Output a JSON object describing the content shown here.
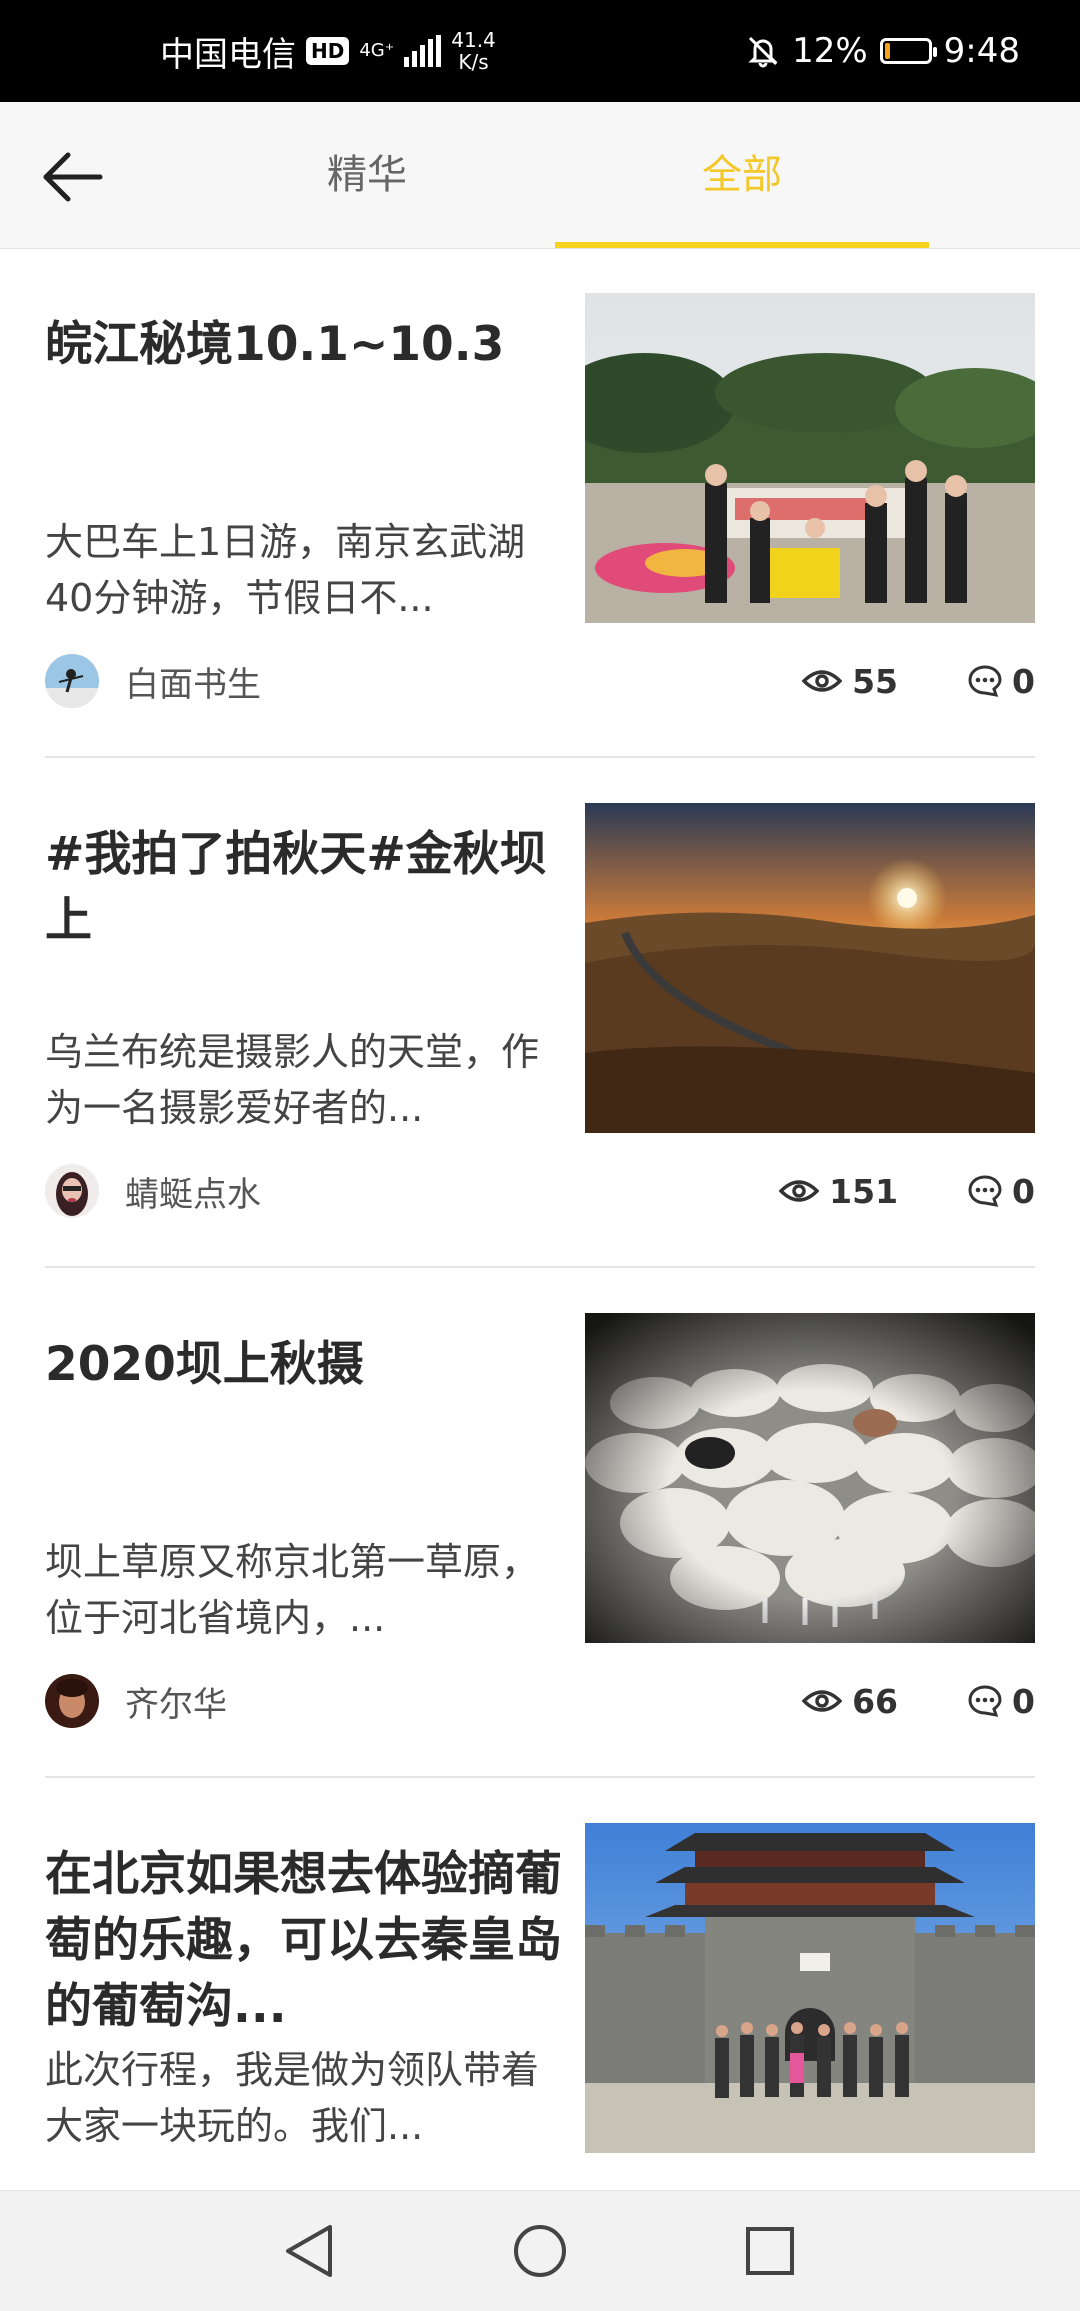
{
  "status_bar": {
    "carrier": "中国电信",
    "hd": "HD",
    "network": "4G⁺",
    "speed_value": "41.4",
    "speed_unit": "K/s",
    "battery": "12%",
    "battery_level": 0.12,
    "time": "9:48"
  },
  "header": {
    "tabs": [
      {
        "label": "精华",
        "active": false
      },
      {
        "label": "全部",
        "active": true
      }
    ],
    "accent_color": "#f5c829"
  },
  "posts": [
    {
      "title": "皖江秘境10.1~10.3",
      "summary": "大巴车上1日游，南京玄武湖40分钟游，节假日不...",
      "author": "白面书生",
      "views": "55",
      "comments": "0"
    },
    {
      "title": "#我拍了拍秋天#金秋坝上",
      "summary": "乌兰布统是摄影人的天堂，作为一名摄影爱好者的...",
      "author": "蜻蜓点水",
      "views": "151",
      "comments": "0"
    },
    {
      "title": "2020坝上秋摄",
      "summary": "坝上草原又称京北第一草原，位于河北省境内，...",
      "author": "齐尔华",
      "views": "66",
      "comments": "0"
    },
    {
      "title": "在北京如果想去体验摘葡萄的乐趣，可以去秦皇岛的葡萄沟...",
      "summary": "此次行程，我是做为领队带着大家一块玩的。我们...",
      "author": "",
      "views": "",
      "comments": ""
    }
  ]
}
